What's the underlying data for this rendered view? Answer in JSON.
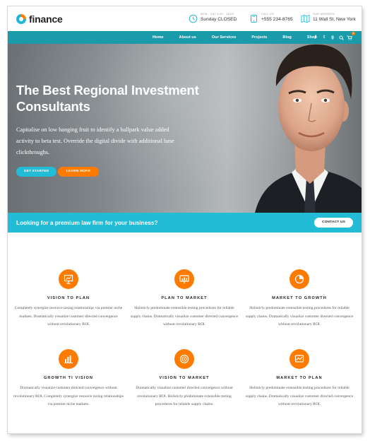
{
  "brand": {
    "name": "finance"
  },
  "header_info": [
    {
      "small": "MON - SAT 8.00 - 18.00",
      "main": "Sunday CLOSED",
      "icon": "clock-icon"
    },
    {
      "small": "CALL US",
      "main": "+555 234-8765",
      "icon": "phone-icon"
    },
    {
      "small": "OUR ADDRESS",
      "main": "11 Wall St, New York",
      "icon": "map-icon"
    }
  ],
  "nav": {
    "items": [
      "Home",
      "About us",
      "Our Services",
      "Projects",
      "Blog",
      "Shop"
    ],
    "social": [
      "f",
      "t",
      "g"
    ],
    "cart_count": "0"
  },
  "hero": {
    "title": "The Best Regional Investment Consultants",
    "subtitle": "Capitalise on low hanging fruit to identify a ballpark value added activity to beta test. Override the digital divide with additional base clickthroughs.",
    "primary_button": "GET STARTED",
    "secondary_button": "LEARN MORE"
  },
  "banner": {
    "text": "Looking for a premium law firm for your business?",
    "button": "CONTACT US"
  },
  "features": [
    {
      "title": "VISION TO PLAN",
      "icon": "chart-board-icon",
      "text": "Completely synergize resource taxing relationships via premier niche markets. Dramatically visualize customer directed convergence without revolutionary ROI."
    },
    {
      "title": "PLAN TO MARKET",
      "icon": "presentation-icon",
      "text": "Holisticly predominate extensible testing procedures for reliable supply chains. Dramatically visualize customer directed convergence without revolutionary ROI."
    },
    {
      "title": "MARKET TO GROWTH",
      "icon": "pie-chart-icon",
      "text": "Holisticly predominate extensible testing procedures for reliable supply chains. Dramatically visualize customer directed convergence without revolutionary ROI."
    },
    {
      "title": "GROWTH TI VISION",
      "icon": "bar-chart-icon",
      "text": "Dramatically visualize customer directed convergence without revolutionary ROI. Completely synergize resource taxing relationships via premier niche markets."
    },
    {
      "title": "VISION TO MARKET",
      "icon": "target-icon",
      "text": "Dramatically visualize customer directed convergence without revolutionary ROI. Holisticly predominate extensible testing procedures for reliable supply chains."
    },
    {
      "title": "MARKET TO PLAN",
      "icon": "line-chart-icon",
      "text": "Holisticly predominate extensible testing procedures for reliable supply chains. Dramatically visualize customer directed convergence without revolutionary ROI."
    }
  ],
  "colors": {
    "accent": "#ff7b00",
    "cyan": "#22bcd6",
    "nav": "#1b9aaa"
  }
}
